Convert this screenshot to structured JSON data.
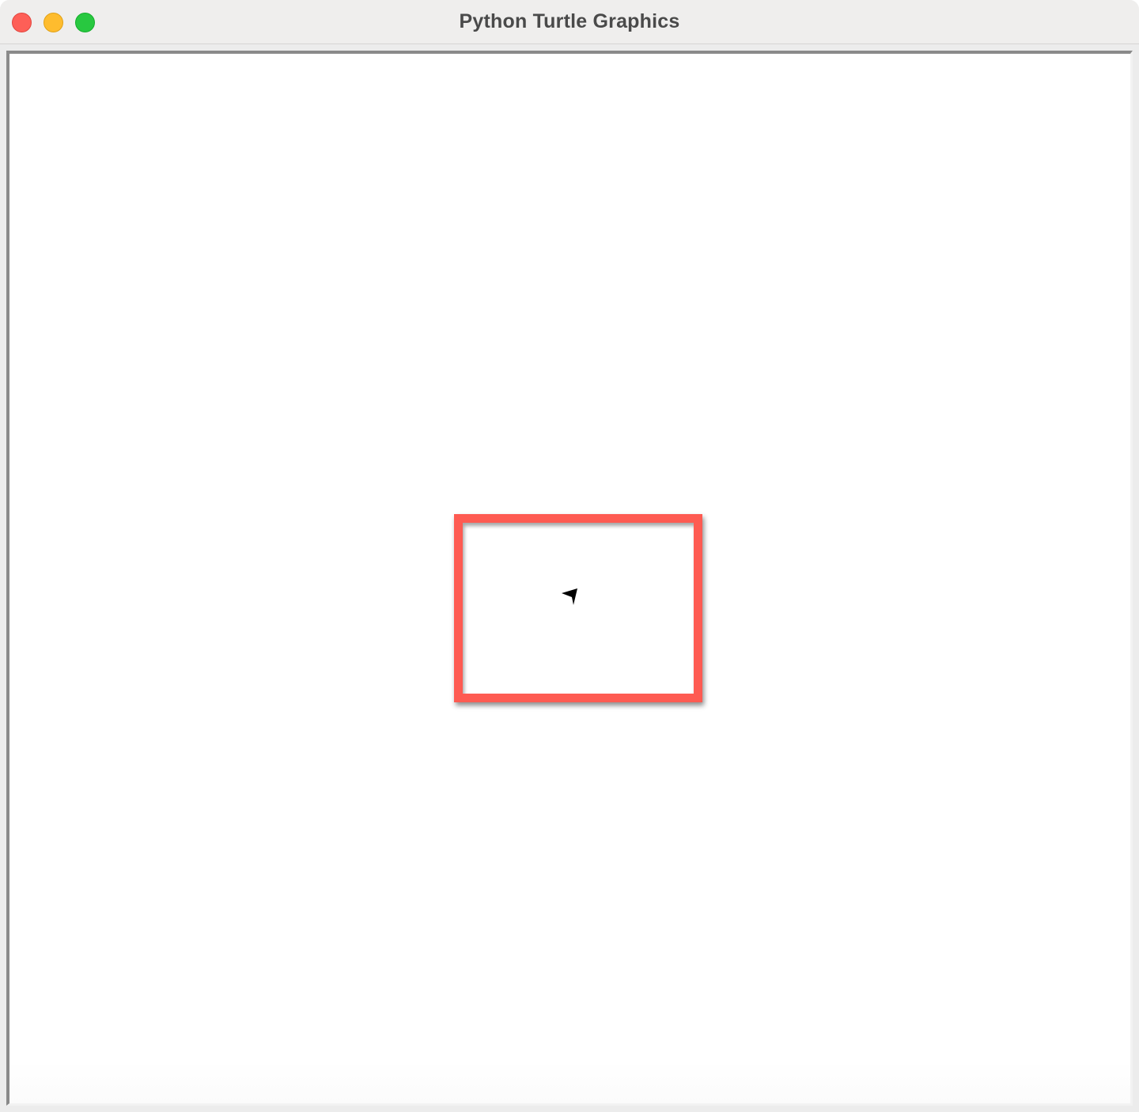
{
  "window": {
    "title": "Python Turtle Graphics"
  },
  "traffic_lights": {
    "close": "close",
    "minimize": "minimize",
    "zoom": "zoom"
  },
  "canvas": {
    "background_color": "#ffffff",
    "drawing": {
      "shape": "rectangle",
      "pen_color": "#fe5b52",
      "fill": "none"
    },
    "turtle": {
      "shape": "arrow",
      "color": "#000000",
      "heading": "up-left"
    }
  }
}
